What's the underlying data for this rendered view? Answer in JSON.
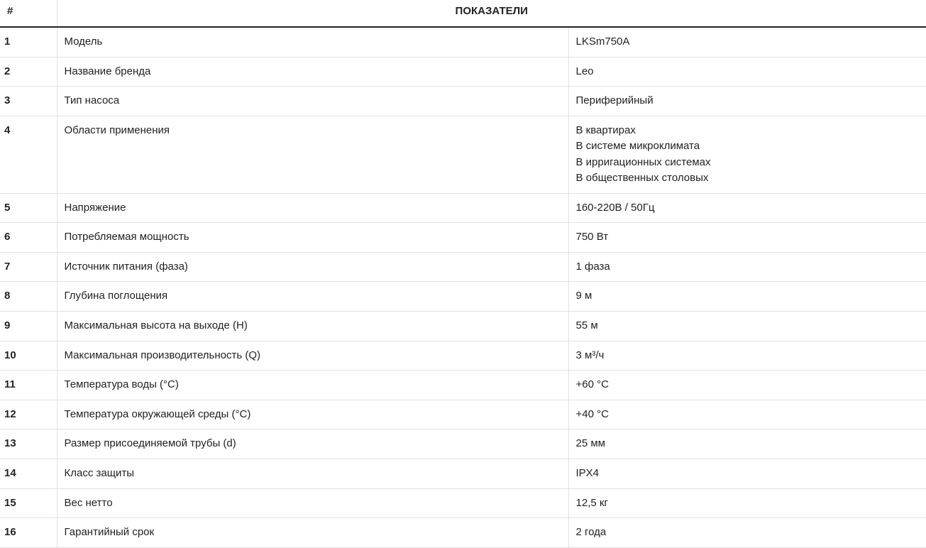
{
  "table": {
    "headers": {
      "number": "#",
      "title": "ПОКАЗАТЕЛИ"
    },
    "rows": [
      {
        "num": "1",
        "name": "Модель",
        "values": [
          "LKSm750A"
        ]
      },
      {
        "num": "2",
        "name": "Название бренда",
        "values": [
          "Leo"
        ]
      },
      {
        "num": "3",
        "name": "Тип насоса",
        "values": [
          "Периферийный"
        ]
      },
      {
        "num": "4",
        "name": "Области применения",
        "values": [
          "В квартирах",
          "В системе микроклимата",
          "В ирригационных системах",
          "В общественных столовых"
        ]
      },
      {
        "num": "5",
        "name": "Напряжение",
        "values": [
          "160-220В / 50Гц"
        ]
      },
      {
        "num": "6",
        "name": "Потребляемая мощность",
        "values": [
          "750 Вт"
        ]
      },
      {
        "num": "7",
        "name": "Источник питания (фаза)",
        "values": [
          "1 фаза"
        ]
      },
      {
        "num": "8",
        "name": "Глубина поглощения",
        "values": [
          "9 м"
        ]
      },
      {
        "num": "9",
        "name": "Максимальная высота на выходе (H)",
        "values": [
          "55 м"
        ]
      },
      {
        "num": "10",
        "name": "Максимальная производительность (Q)",
        "values": [
          "3 м³/ч"
        ]
      },
      {
        "num": "11",
        "name": "Температура воды (°C)",
        "values": [
          "+60 °C"
        ]
      },
      {
        "num": "12",
        "name": "Температура окружающей среды (°C)",
        "values": [
          "+40 °C"
        ]
      },
      {
        "num": "13",
        "name": "Размер присоединяемой трубы (d)",
        "values": [
          "25 мм"
        ]
      },
      {
        "num": "14",
        "name": "Класс защиты",
        "values": [
          "IPX4"
        ]
      },
      {
        "num": "15",
        "name": "Вес нетто",
        "values": [
          "12,5 кг"
        ]
      },
      {
        "num": "16",
        "name": "Гарантийный срок",
        "values": [
          "2 года"
        ]
      }
    ]
  },
  "colors": {
    "text": "#222222",
    "border": "#e1e1e1",
    "header_rule": "#222222",
    "background": "#ffffff"
  }
}
